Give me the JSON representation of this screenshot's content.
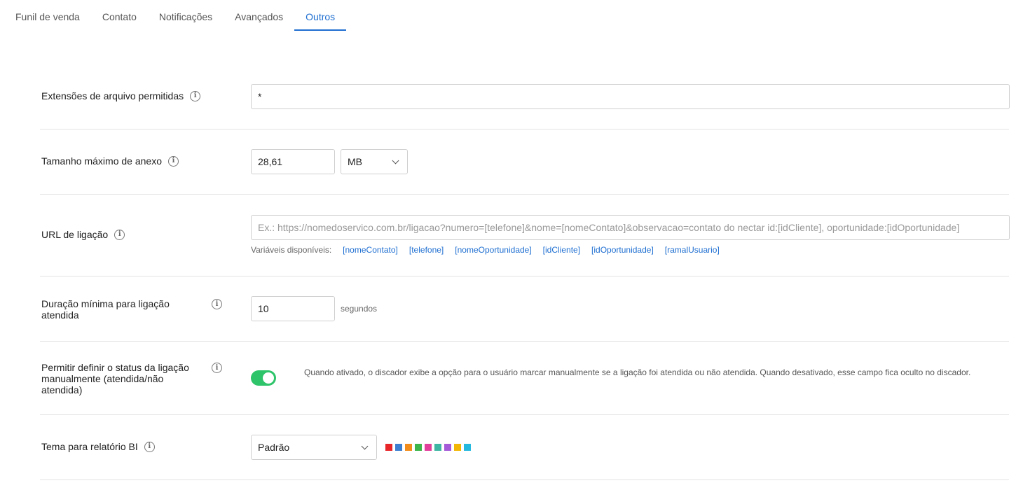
{
  "tabs": [
    {
      "label": "Funil de venda",
      "active": false
    },
    {
      "label": "Contato",
      "active": false
    },
    {
      "label": "Notificações",
      "active": false
    },
    {
      "label": "Avançados",
      "active": false
    },
    {
      "label": "Outros",
      "active": true
    }
  ],
  "file_extensions": {
    "label": "Extensões de arquivo permitidas",
    "value": "*"
  },
  "max_attachment": {
    "label": "Tamanho máximo de anexo",
    "value": "28,61",
    "unit": "MB"
  },
  "call_url": {
    "label": "URL de ligação",
    "placeholder": "Ex.: https://nomedoservico.com.br/ligacao?numero=[telefone]&nome=[nomeContato]&observacao=contato do nectar id:[idCliente], oportunidade:[idOportunidade]",
    "vars_label": "Variáveis disponíveis:",
    "vars": [
      "[nomeContato]",
      "[telefone]",
      "[nomeOportunidade]",
      "[idCliente]",
      "[idOportunidade]",
      "[ramalUsuario]"
    ]
  },
  "min_duration": {
    "label": "Duração mínima para ligação atendida",
    "value": "10",
    "suffix": "segundos"
  },
  "manual_status": {
    "label": "Permitir definir o status da ligação manualmente (atendida/não atendida)",
    "enabled": true,
    "description": "Quando ativado, o discador exibe a opção para o usuário marcar manualmente se a ligação foi atendida ou não atendida. Quando desativado, esse campo fica oculto no discador."
  },
  "bi_theme": {
    "label": "Tema para relatório BI",
    "value": "Padrão",
    "palette": [
      "#e8262a",
      "#3d7fd1",
      "#f28c1a",
      "#3cb54a",
      "#e23f9a",
      "#3fb5a3",
      "#a55ad8",
      "#f2b705",
      "#25b9e0"
    ]
  }
}
